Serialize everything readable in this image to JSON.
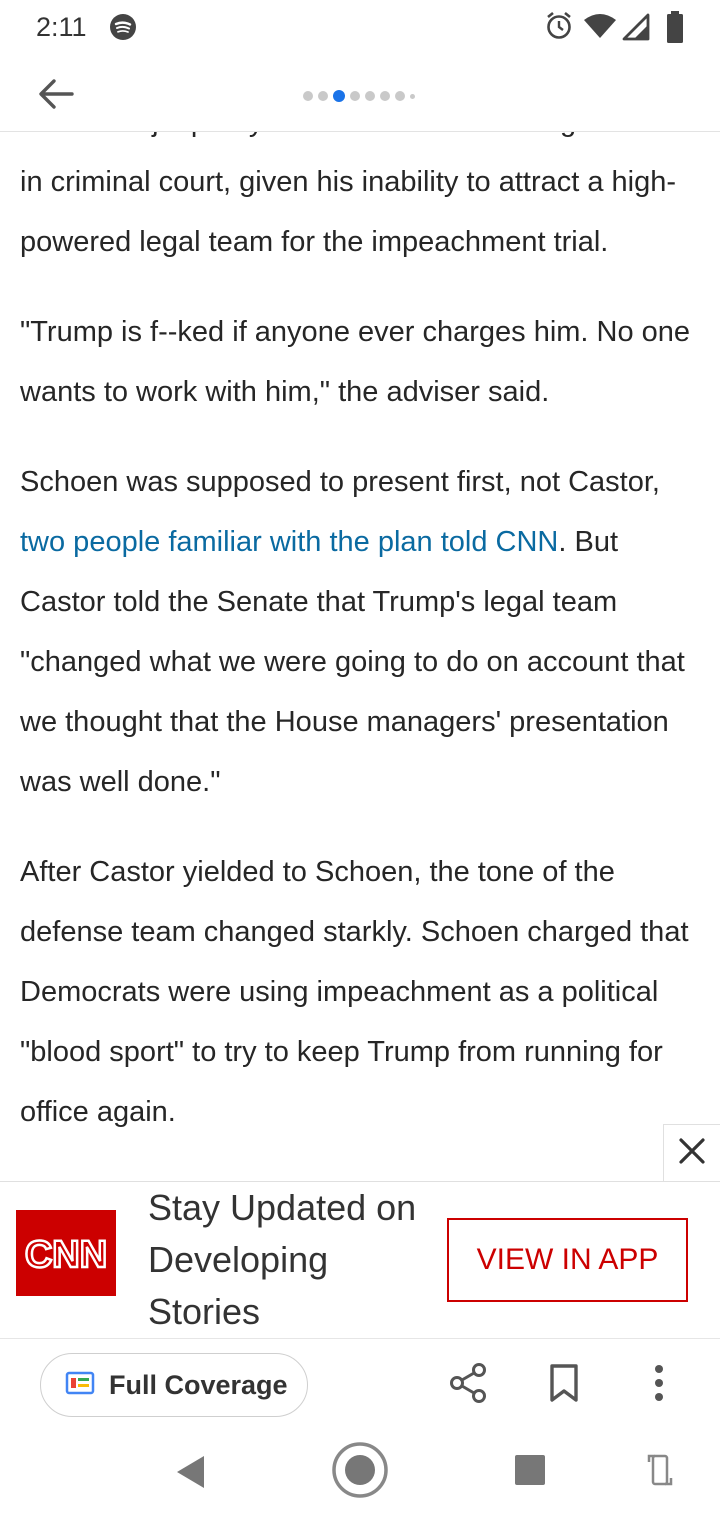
{
  "status_bar": {
    "time": "2:11",
    "icons": [
      "spotify-icon",
      "alarm-icon",
      "wifi-icon",
      "signal-icon",
      "battery-icon"
    ]
  },
  "app_bar": {
    "back_icon": "arrow-back-icon",
    "page_indicator": {
      "dots": 8,
      "active_index": 2
    }
  },
  "article": {
    "clipped_top_line": "in serious jeopardy if he finds himself charged",
    "paragraphs": [
      {
        "text": "in criminal court, given his inability to attract a high-powered legal team for the impeachment trial."
      },
      {
        "text": "\"Trump is f--ked if anyone ever charges him. No one wants to work with him,\" the adviser said."
      },
      {
        "before": "Schoen was supposed to present first, not Castor, ",
        "link": "two people familiar with the plan told CNN",
        "after": ". But Castor told the Senate that Trump's legal team \"changed what we were going to do on account that we thought that the House managers' presentation was well done.\""
      },
      {
        "text": "After Castor yielded to Schoen, the tone of the defense team changed starkly. Schoen charged that Democrats were using impeachment as a political \"blood sport\" to try to keep Trump from running for office again."
      }
    ],
    "link_color": "#0a6aa1"
  },
  "promo": {
    "logo_text": "CNN",
    "headline": "Stay Updated on Developing Stories",
    "cta_label": "VIEW IN APP",
    "close_icon": "close-icon",
    "brand_color": "#cc0000"
  },
  "toolbar": {
    "full_coverage_label": "Full Coverage",
    "icons": [
      "full-coverage-icon",
      "share-icon",
      "bookmark-icon",
      "more-vert-icon"
    ]
  },
  "nav_bar": {
    "icons": [
      "nav-back-icon",
      "nav-home-icon",
      "nav-recents-icon",
      "rotate-icon"
    ]
  },
  "colors": {
    "accent": "#1a73e8",
    "text": "#262626"
  }
}
